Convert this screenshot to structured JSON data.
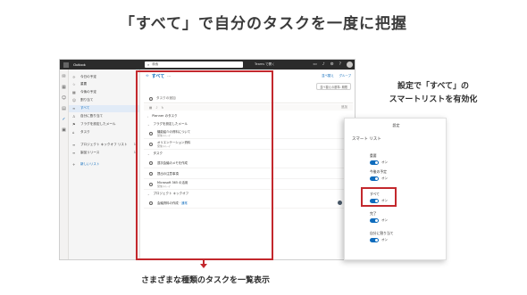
{
  "headline": "「すべて」で自分のタスクを一度に把握",
  "app": {
    "name": "Outlook",
    "search_placeholder": "検索",
    "teams_link": "Teams で開く"
  },
  "sidebar": {
    "items": [
      {
        "label": "今日の予定",
        "icon": "sun-icon"
      },
      {
        "label": "重要",
        "icon": "star-icon"
      },
      {
        "label": "今後の予定",
        "icon": "calendar-icon"
      },
      {
        "label": "割り当て",
        "icon": "user-icon"
      },
      {
        "label": "すべて",
        "icon": "all-icon",
        "active": true
      },
      {
        "label": "自分に割り当て",
        "icon": "person-icon"
      },
      {
        "label": "フラグを設定したメール",
        "icon": "flag-icon"
      },
      {
        "label": "タスク",
        "icon": "home-icon"
      }
    ],
    "lists": [
      {
        "label": "プロジェクト キックオフ リスト",
        "icon": "list-icon",
        "count": "1"
      },
      {
        "label": "製品リリース",
        "icon": "list-icon",
        "count": "1"
      }
    ],
    "new_list": "新しいリスト"
  },
  "main": {
    "title": "すべて",
    "actions": [
      "並べ替え",
      "グループ"
    ],
    "sort_chip": "並べ替えの基準: 期限",
    "add_task_placeholder": "タスクの追加",
    "add_button": "追加",
    "groups": [
      {
        "label": "Planner のタスク",
        "tasks": []
      },
      {
        "label": "フラグを設定したメール",
        "tasks": [
          {
            "title": "機能紹介の資料について",
            "sub": "受信トレイ"
          },
          {
            "title": "オリエンテーション資料",
            "sub": "受信トレイ"
          }
        ]
      },
      {
        "label": "タスク",
        "tasks": [
          {
            "title": "週次会議のメモを作成",
            "sub": ""
          },
          {
            "title": "提出の注意事項",
            "sub": ""
          },
          {
            "title": "Microsoft 365 の活用",
            "sub": "受信トレイ"
          }
        ]
      },
      {
        "label": "プロジェクト キックオフ",
        "tasks": [
          {
            "title": "会議資料の作成",
            "tag": "通常",
            "sub": ""
          }
        ]
      }
    ]
  },
  "side_caption": [
    "設定で「すべて」の",
    "スマートリストを有効化"
  ],
  "bottom_caption": "さまざまな種類のタスクを一覧表示",
  "settings_panel": {
    "title": "設定",
    "subtitle": "スマート リスト",
    "items": [
      {
        "name": "重要",
        "value": "オン"
      },
      {
        "name": "今後の予定",
        "value": "オン"
      },
      {
        "name": "すべて",
        "value": "オン"
      },
      {
        "name": "完了",
        "value": "オン"
      },
      {
        "name": "自分に割り当て",
        "value": "オン"
      }
    ]
  },
  "colors": {
    "accent": "#0f6cbd",
    "highlight": "#c3282d",
    "topbar": "#2b2b2b"
  }
}
